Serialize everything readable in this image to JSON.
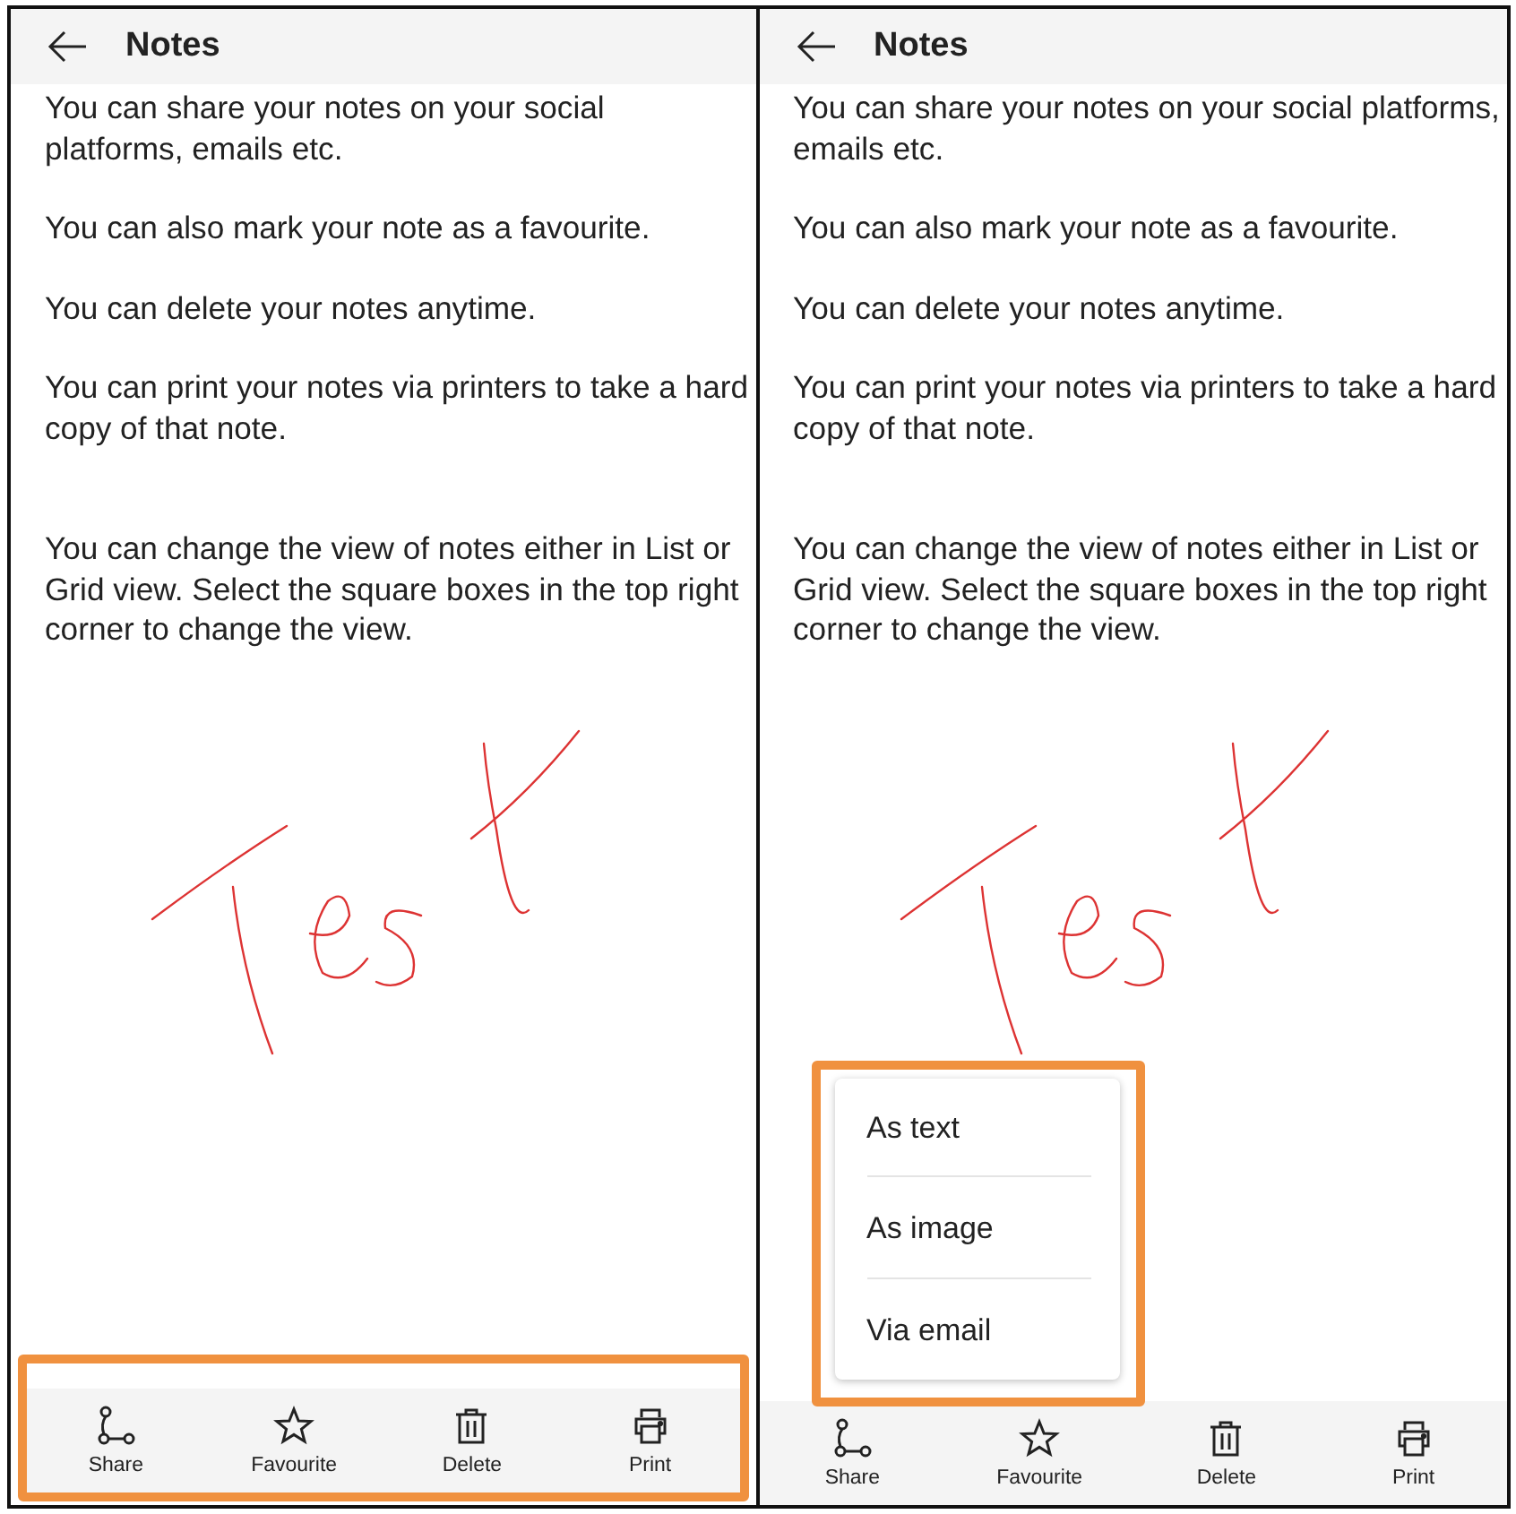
{
  "panels": [
    {
      "title": "Notes",
      "paragraphs": [
        "You can share your notes on your social platforms, emails etc.",
        "You can also mark your note as a favourite.",
        "You can delete your notes anytime.",
        "You can print your notes via printers to take a hard copy of that note.",
        "You can change the view of notes either in List or Grid view. Select the square boxes in the top right corner to change the view."
      ],
      "toolbar": {
        "highlighted": true,
        "buttons": [
          {
            "kind": "share",
            "label": "Share"
          },
          {
            "kind": "favourite",
            "label": "Favourite"
          },
          {
            "kind": "delete",
            "label": "Delete"
          },
          {
            "kind": "print",
            "label": "Print"
          }
        ]
      }
    },
    {
      "title": "Notes",
      "paragraphs": [
        "You can share your notes on your social platforms, emails etc.",
        "You can also mark your note as a favourite.",
        "You can delete your notes anytime.",
        "You can print your notes via printers to take a hard copy of that note.",
        "You can change the view of notes either in List or Grid view. Select the square boxes in the top right corner to change the view."
      ],
      "menu": {
        "highlighted": true,
        "items": [
          "As text",
          "As image",
          "Via email"
        ]
      },
      "toolbar": {
        "highlighted": false,
        "buttons": [
          {
            "kind": "share",
            "label": "Share"
          },
          {
            "kind": "favourite",
            "label": "Favourite"
          },
          {
            "kind": "delete",
            "label": "Delete"
          },
          {
            "kind": "print",
            "label": "Print"
          }
        ]
      }
    }
  ]
}
